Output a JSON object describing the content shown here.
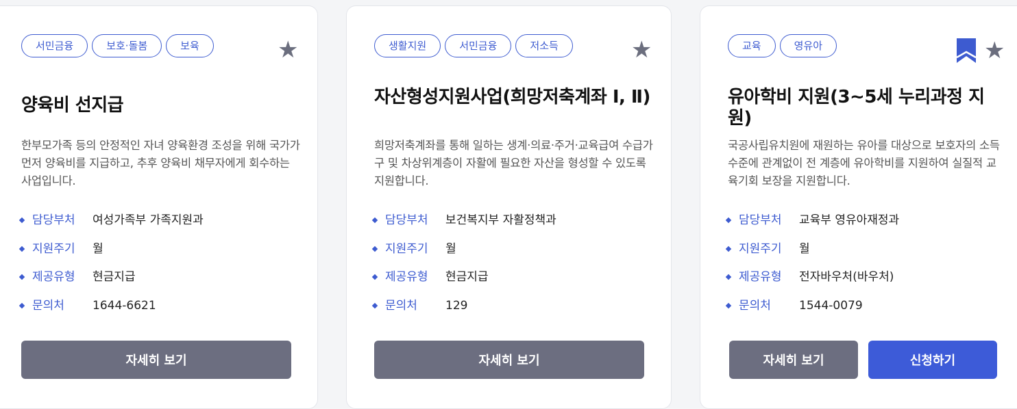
{
  "cards": [
    {
      "tags": [
        "서민금융",
        "보호·돌봄",
        "보육"
      ],
      "bookmarked": false,
      "star_icon": "star-icon",
      "title": "양육비 선지급",
      "description": "한부모가족 등의 안정적인 자녀 양육환경 조성을 위해 국가가 먼저 양육비를 지급하고, 추후 양육비 채무자에게 회수하는 사업입니다.",
      "info": [
        {
          "label": "담당부처",
          "value": "여성가족부 가족지원과"
        },
        {
          "label": "지원주기",
          "value": "월"
        },
        {
          "label": "제공유형",
          "value": "현금지급"
        },
        {
          "label": "문의처",
          "value": "1644-6621"
        }
      ],
      "detail_label": "자세히 보기"
    },
    {
      "tags": [
        "생활지원",
        "서민금융",
        "저소득"
      ],
      "bookmarked": false,
      "star_icon": "star-icon",
      "title": "자산형성지원사업(희망저축계좌 Ⅰ, Ⅱ)",
      "description": "희망저축계좌를 통해 일하는 생계·의료·주거·교육급여 수급가구 및 차상위계층이 자활에 필요한 자산을 형성할 수 있도록 지원합니다.",
      "info": [
        {
          "label": "담당부처",
          "value": "보건복지부 자활정책과"
        },
        {
          "label": "지원주기",
          "value": "월"
        },
        {
          "label": "제공유형",
          "value": "현금지급"
        },
        {
          "label": "문의처",
          "value": "129"
        }
      ],
      "detail_label": "자세히 보기"
    },
    {
      "tags": [
        "교육",
        "영유아"
      ],
      "bookmarked": true,
      "bookmark_icon": "bookmark-icon",
      "star_icon": "star-icon",
      "title": "유아학비 지원(3~5세 누리과정 지원)",
      "description": "국공사립유치원에 재원하는 유아를 대상으로 보호자의 소득수준에 관계없이 전 계층에 유아학비를 지원하여 실질적 교육기회 보장을 지원합니다.",
      "info": [
        {
          "label": "담당부처",
          "value": "교육부 영유아재정과"
        },
        {
          "label": "지원주기",
          "value": "월"
        },
        {
          "label": "제공유형",
          "value": "전자바우처(바우처)"
        },
        {
          "label": "문의처",
          "value": "1544-0079"
        }
      ],
      "detail_label": "자세히 보기",
      "apply_label": "신청하기"
    }
  ],
  "colors": {
    "accent_blue": "#3d5bd0",
    "button_gray": "#6c6e80",
    "button_blue": "#3d5bd8",
    "icon_gray": "#6b6e7e"
  }
}
